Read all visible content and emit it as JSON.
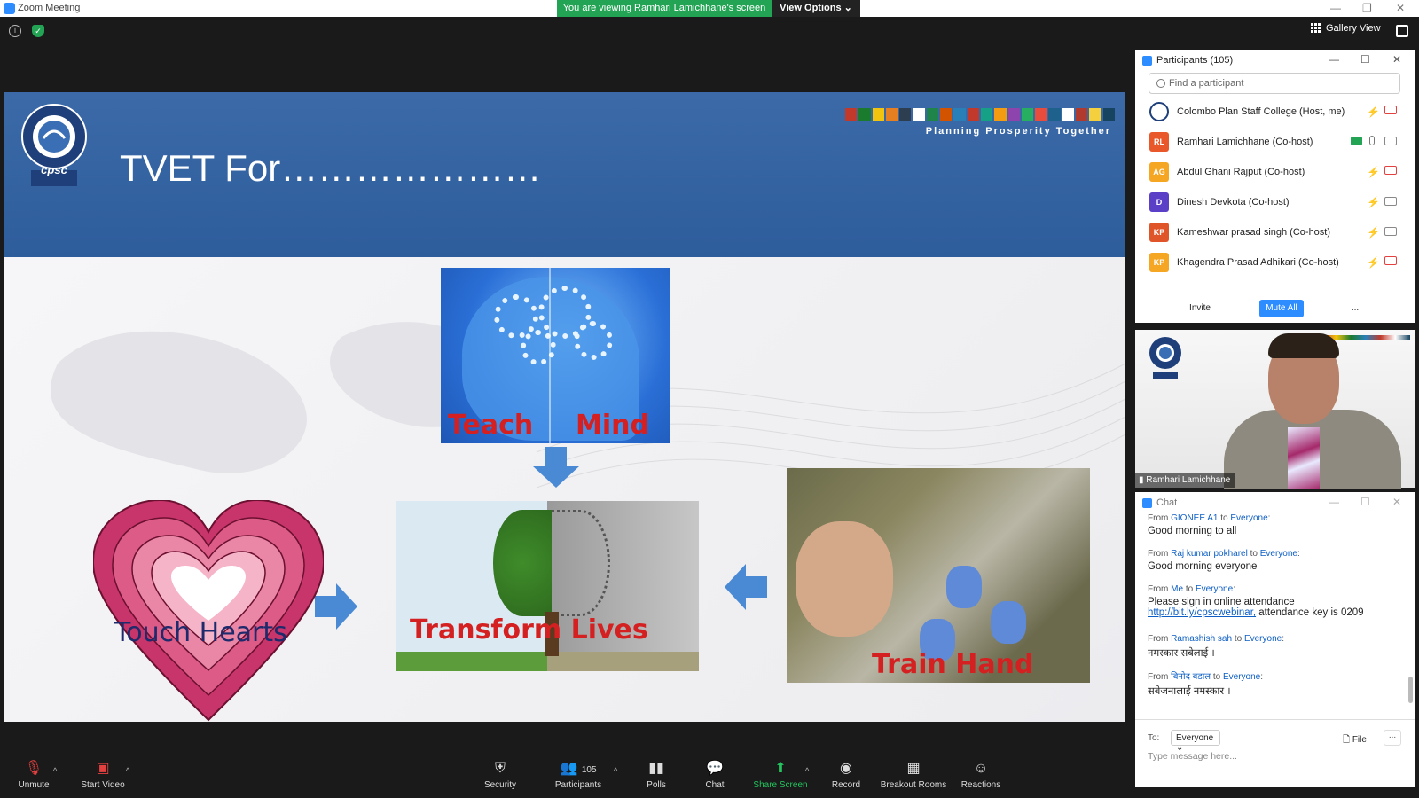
{
  "window": {
    "title": "Zoom Meeting",
    "share_banner": "You are viewing Ramhari Lamichhane's screen",
    "view_options": "View Options",
    "gallery_view": "Gallery View"
  },
  "slide": {
    "title": "TVET For…………………",
    "tagline": "Planning Prosperity Together",
    "logo_text": "cpsc",
    "captions": {
      "teach": "Teach",
      "mind": "Mind",
      "transform": "Transform Lives",
      "touch": "Touch Hearts",
      "train": "Train Hand"
    },
    "flag_colors": [
      "#c0392b",
      "#1a7a2e",
      "#f1c40f",
      "#e67e22",
      "#2c3e50",
      "#ffffff",
      "#1e8449",
      "#d35400",
      "#2980b9",
      "#c0392b",
      "#16a085",
      "#f39c12",
      "#8e44ad",
      "#27ae60",
      "#e74c3c",
      "#1f618d",
      "#ffffff",
      "#b03a2e",
      "#f4d03f",
      "#154360"
    ]
  },
  "participants": {
    "title": "Participants (105)",
    "search_placeholder": "Find a participant",
    "list": [
      {
        "name": "Colombo Plan Staff College (Host, me)",
        "initials": "",
        "color": "#ffffff",
        "mic": "off",
        "video": "off"
      },
      {
        "name": "Ramhari Lamichhane (Co-host)",
        "initials": "RL",
        "color": "#e8582a",
        "mic": "on",
        "video": "on",
        "sharing": true
      },
      {
        "name": "Abdul Ghani Rajput (Co-host)",
        "initials": "AG",
        "color": "#f5a623",
        "mic": "off",
        "video": "off"
      },
      {
        "name": "Dinesh Devkota (Co-host)",
        "initials": "D",
        "color": "#5b3fc6",
        "mic": "off",
        "video": "on"
      },
      {
        "name": "Kameshwar prasad singh (Co-host)",
        "initials": "KP",
        "color": "#e0542a",
        "mic": "off",
        "video": "on"
      },
      {
        "name": "Khagendra Prasad Adhikari (Co-host)",
        "initials": "KP",
        "color": "#f5a623",
        "mic": "off",
        "video": "off"
      }
    ],
    "invite": "Invite",
    "mute_all": "Mute All",
    "more": "..."
  },
  "video": {
    "name": "Ramhari Lamichhane"
  },
  "chat": {
    "title": "Chat",
    "messages": [
      {
        "from": "GIONEE A1",
        "to": "Everyone",
        "text": "Good morning to all"
      },
      {
        "from": "Raj kumar pokharel",
        "to": "Everyone",
        "text": "Good morning everyone"
      },
      {
        "from": "Me",
        "to": "Everyone",
        "text": "Please sign in online attendance",
        "link": "http://bit.ly/cpscwebinar,",
        "after_link": " attendance key is 0209"
      },
      {
        "from": "Ramashish sah",
        "to": "Everyone",
        "text": "नमस्कार सबेलाई ।"
      },
      {
        "from": "बिनोद बडाल",
        "to": "Everyone",
        "text": "सबेजनालाई नमस्कार ।"
      }
    ],
    "from_label": "From",
    "to_label": "to",
    "send_to_label": "To:",
    "recipient": "Everyone",
    "file_label": "File",
    "input_placeholder": "Type message here..."
  },
  "toolbar": {
    "unmute": "Unmute",
    "start_video": "Start Video",
    "security": "Security",
    "participants": "Participants",
    "participants_count": "105",
    "polls": "Polls",
    "chat": "Chat",
    "share_screen": "Share Screen",
    "record": "Record",
    "breakout_rooms": "Breakout Rooms",
    "reactions": "Reactions"
  },
  "colors": {
    "share_green": "#23a455",
    "zoom_blue": "#2d8cff",
    "slide_header": "#2e5d9c",
    "caption_red": "#d42020",
    "mute_red": "#e34040"
  }
}
